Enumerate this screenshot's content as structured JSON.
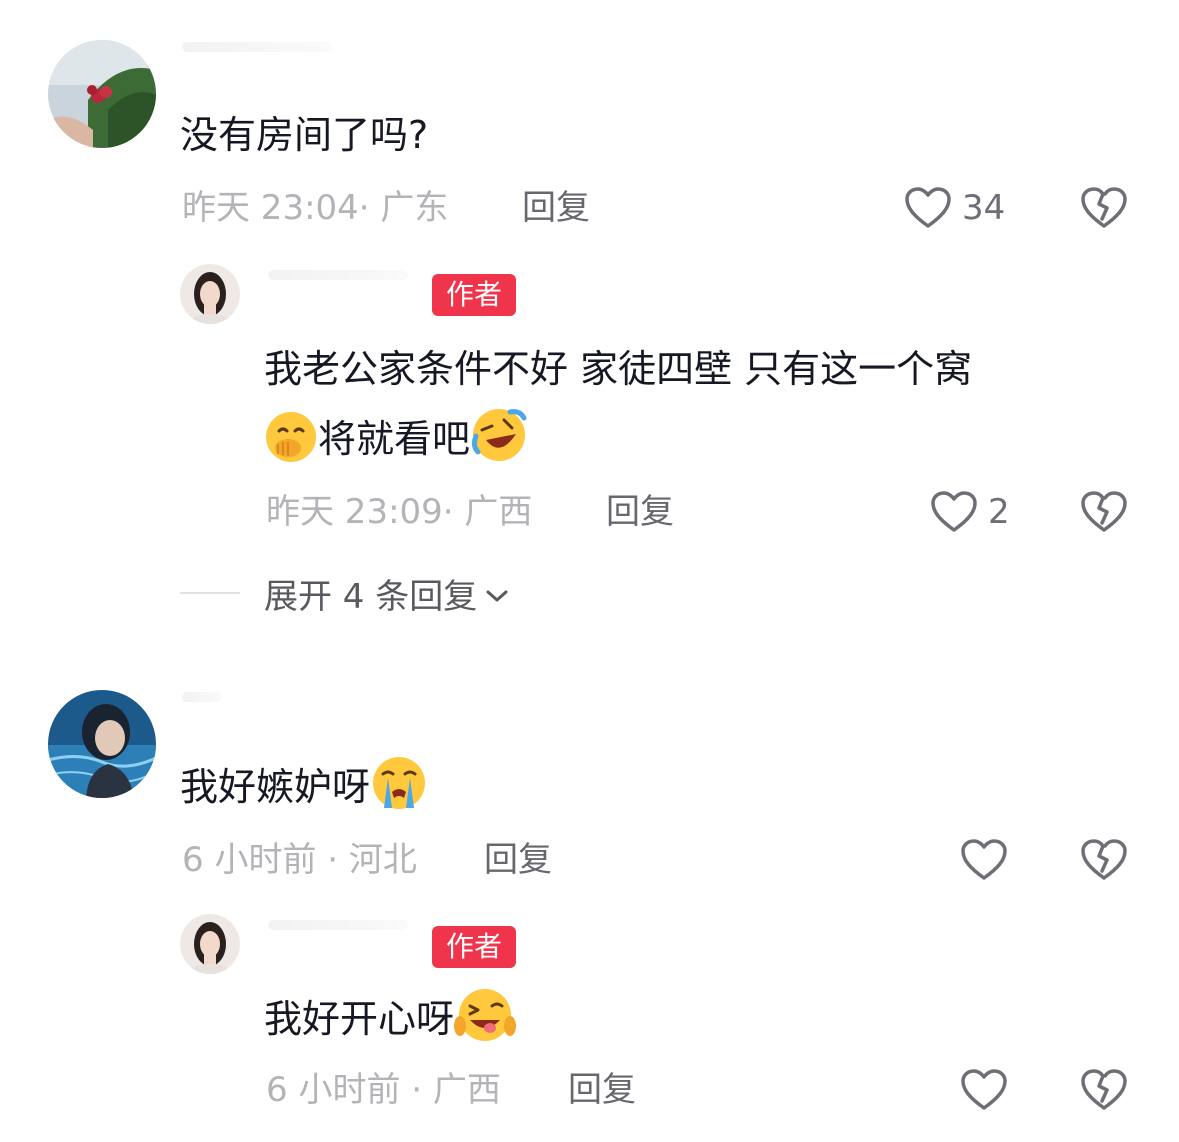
{
  "comments": [
    {
      "text": "没有房间了吗?",
      "meta": "昨天 23:04· 广东",
      "reply_label": "回复",
      "likes": "34",
      "reply": {
        "badge": "作者",
        "text_line1": "我老公家条件不好 家徒四壁 只有这一个窝",
        "text_line2": "将就看吧",
        "meta": "昨天 23:09· 广西",
        "reply_label": "回复",
        "likes": "2"
      },
      "expand_label": "展开 4 条回复"
    },
    {
      "text": "我好嫉妒呀",
      "meta": "6 小时前 · 河北",
      "reply_label": "回复",
      "reply": {
        "badge": "作者",
        "text": "我好开心呀",
        "meta": "6 小时前 · 广西",
        "reply_label": "回复"
      }
    }
  ],
  "icons": {
    "like": "heart-outline-icon",
    "dislike": "broken-heart-icon",
    "expand": "chevron-down-icon"
  },
  "colors": {
    "author_badge": "#f0344c",
    "meta_text": "#b3b3b8",
    "icon": "#6e6e76"
  }
}
